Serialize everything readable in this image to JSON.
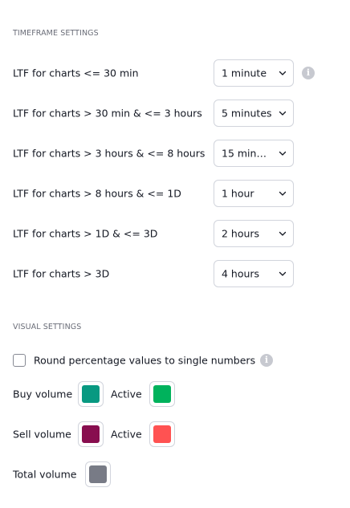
{
  "timeframe_settings": {
    "title": "TIMEFRAME SETTINGS",
    "rows": [
      {
        "label": "LTF for charts <= 30 min",
        "value": "1 minute"
      },
      {
        "label": "LTF for charts > 30 min & <= 3 hours",
        "value": "5 minutes"
      },
      {
        "label": "LTF for charts > 3 hours & <= 8 hours",
        "value": "15 minu..."
      },
      {
        "label": "LTF for charts > 8 hours & <= 1D",
        "value": "1 hour"
      },
      {
        "label": "LTF for charts > 1D & <= 3D",
        "value": "2 hours"
      },
      {
        "label": "LTF for charts > 3D",
        "value": "4 hours"
      }
    ],
    "info_icon": "info-icon"
  },
  "visual_settings": {
    "title": "VISUAL SETTINGS",
    "round_checkbox": {
      "label": "Round percentage values to single numbers",
      "checked": false
    },
    "buy_volume": {
      "label": "Buy volume",
      "color": "#089981",
      "active_label": "Active",
      "active_color": "#00b25c"
    },
    "sell_volume": {
      "label": "Sell volume",
      "color": "#880e4f",
      "active_label": "Active",
      "active_color": "#ff5252"
    },
    "total_volume": {
      "label": "Total volume",
      "color": "#787b86"
    }
  }
}
